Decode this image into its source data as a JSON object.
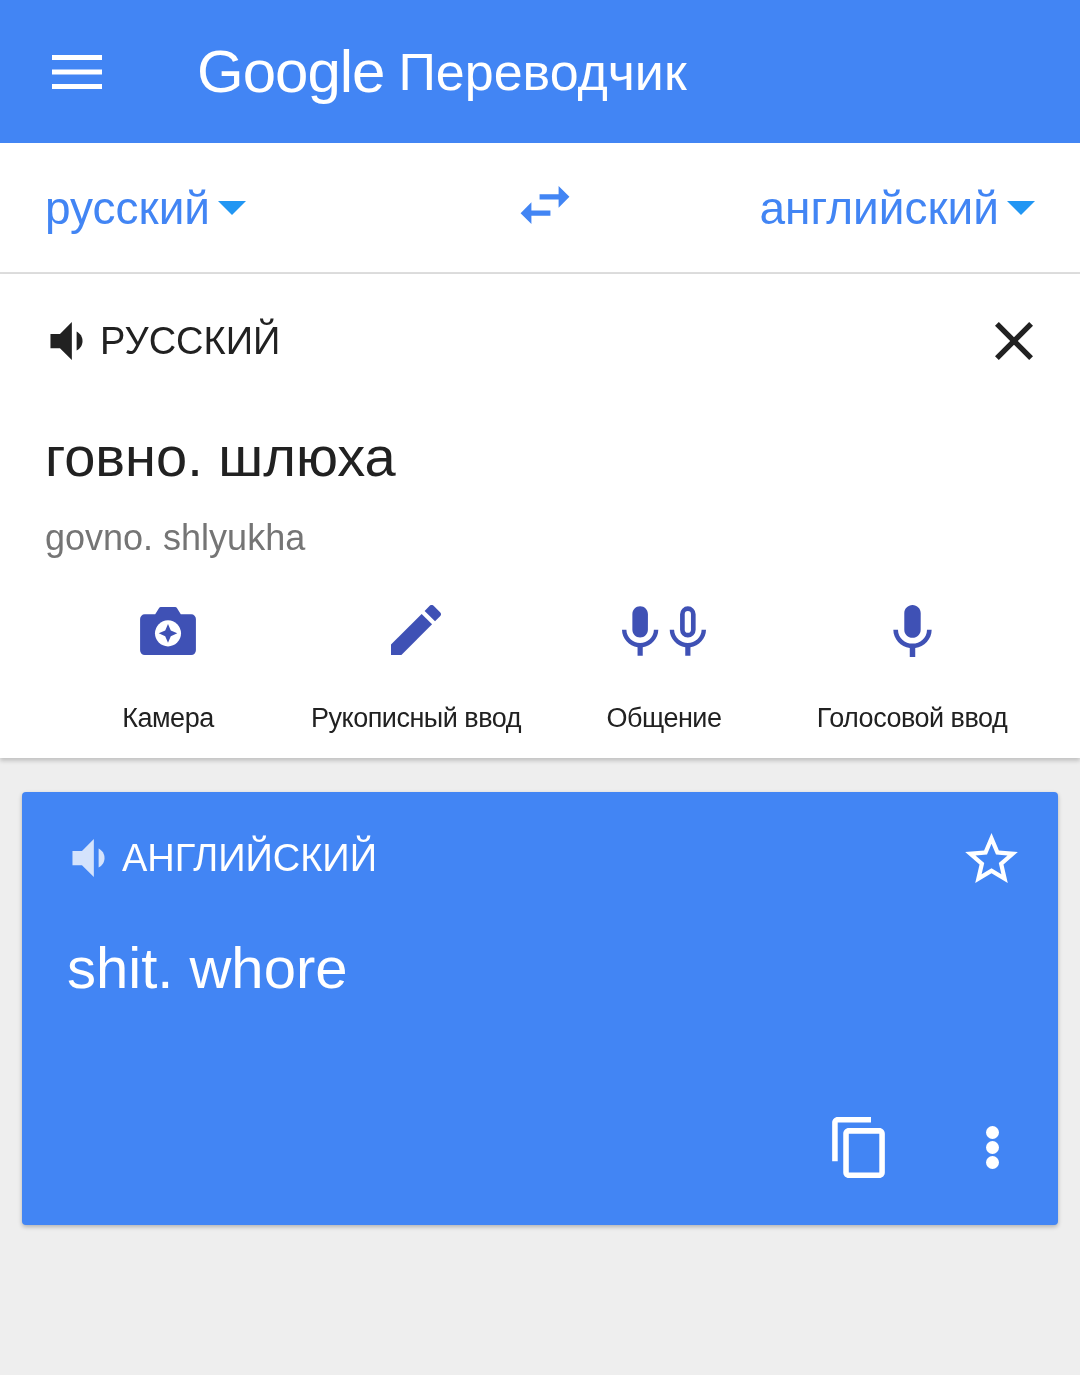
{
  "app_bar": {
    "logo": "Google",
    "title": "Переводчик"
  },
  "language_bar": {
    "source": "русский",
    "target": "английский"
  },
  "input": {
    "language": "РУССКИЙ",
    "text": "говно. шлюха",
    "transliteration": "govno. shlyukha",
    "tools": [
      {
        "kind": "camera",
        "label": "Камера"
      },
      {
        "kind": "handwriting",
        "label": "Рукописный ввод"
      },
      {
        "kind": "conversation",
        "label": "Общение"
      },
      {
        "kind": "voice",
        "label": "Голосовой ввод"
      }
    ]
  },
  "output": {
    "language": "АНГЛИЙСКИЙ",
    "text": "shit. whore",
    "starred": false
  }
}
